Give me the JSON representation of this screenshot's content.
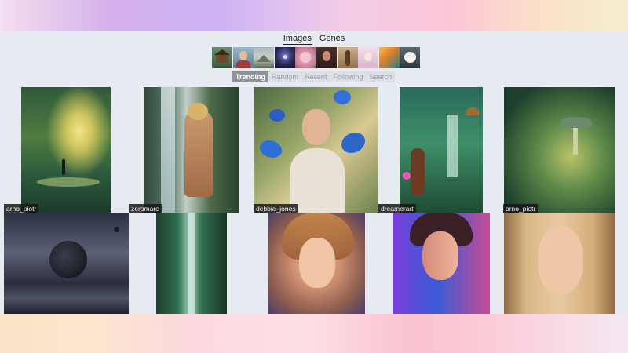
{
  "nav": {
    "images": "Images",
    "genes": "Genes"
  },
  "genes": [
    {
      "icon": "hut-thumbnail"
    },
    {
      "icon": "woman-portrait-thumbnail"
    },
    {
      "icon": "landscape-thumbnail"
    },
    {
      "icon": "cosmic-figure-thumbnail"
    },
    {
      "icon": "pink-character-thumbnail"
    },
    {
      "icon": "dark-portrait-thumbnail"
    },
    {
      "icon": "warrior-thumbnail"
    },
    {
      "icon": "anime-girl-thumbnail"
    },
    {
      "icon": "city-painting-thumbnail"
    },
    {
      "icon": "white-dog-thumbnail"
    }
  ],
  "tabs": [
    "Trending",
    "Random",
    "Recent",
    "Following",
    "Search"
  ],
  "images": [
    {
      "caption": "arno_piotr"
    },
    {
      "caption": "zeromare"
    },
    {
      "caption": "debbie_jones"
    },
    {
      "caption": "dreamerart"
    },
    {
      "caption": "arno_piotr"
    }
  ],
  "colors": {
    "active_tab": "#8e9399",
    "caption_bg": "#181818",
    "page_bg": "#e6ebf1"
  }
}
